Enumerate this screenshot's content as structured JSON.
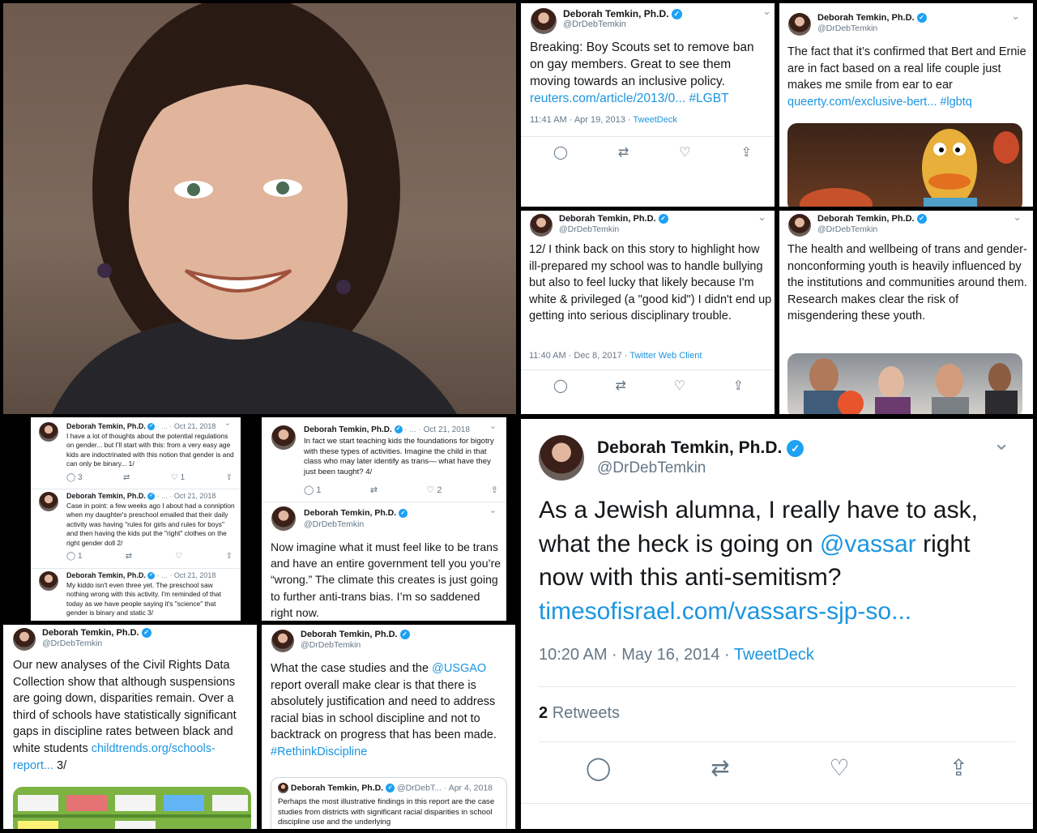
{
  "profile": {
    "name": "Deborah Temkin, Ph.D.",
    "handle": "@DrDebTemkin",
    "verified_mark": "✓"
  },
  "icons": {
    "reply": "reply-icon",
    "retweet": "retweet-icon",
    "like": "like-icon",
    "share": "share-icon",
    "chevron": "chevron-down-icon",
    "verified": "verified-badge-icon"
  },
  "glyphs": {
    "reply": "◯",
    "retweet": "⇄",
    "like": "♡",
    "share": "⇪",
    "chevron": "⌄"
  },
  "colors": {
    "link": "#1b95e0",
    "badge": "#1da1f2",
    "muted": "#657786"
  },
  "tweets": {
    "boy_scouts": {
      "text": "Breaking: Boy Scouts set to remove ban on gay members. Great to see them moving towards an inclusive policy.",
      "link": "reuters.com/article/2013/0...",
      "hashtag": "#LGBT",
      "time": "11:41 AM · Apr 19, 2013 ·",
      "source": "TweetDeck"
    },
    "bert_ernie": {
      "text": "The fact that it’s confirmed that Bert and Ernie are in fact based on a real life couple just makes me smile from ear to ear",
      "link": "queerty.com/exclusive-bert...",
      "hashtag": "#lgbtq"
    },
    "story_12": {
      "text": "12/ I think back on this story to highlight how ill-prepared my school was to handle bullying but also to feel lucky that likely because I'm white & privileged  (a \"good kid\") I didn't end up getting into serious disciplinary trouble.",
      "time": "11:40 AM · Dec 8, 2017 ·",
      "source": "Twitter Web Client"
    },
    "trans_youth": {
      "text": "The health and wellbeing of trans and gender-nonconforming youth is heavily influenced by the institutions and communities around them. Research makes clear the risk of misgendering these youth."
    },
    "thread": [
      {
        "date": "Oct 21, 2018",
        "text": "I have a lot of thoughts about the potential regulations on gender... but I'll start with this: from a very easy age kids are indoctrinated with this notion that gender is and can only be binary... 1/",
        "replies": "3",
        "likes": "1"
      },
      {
        "date": "Oct 21, 2018",
        "text": "Case in point: a few weeks ago I about had a conniption when my daughter's preschool emailed that their daily activity was having \"rules for girls and rules for boys\" and then having the kids put the \"right\" clothes on the right gender doll 2/",
        "replies": "1",
        "likes": ""
      },
      {
        "date": "Oct 21, 2018",
        "text": "My kiddo isn't even three yet. The preschool saw nothing wrong with this activity. I'm reminded of that today as we have people saying it's \"science\" that gender is binary and static 3/",
        "replies": "",
        "likes": ""
      }
    ],
    "thread4": {
      "date": "Oct 21, 2018",
      "text": "In fact we start teaching kids the foundations for bigotry with these types of activities. Imagine the child in that class who may later identify as trans— what have they just been taught? 4/",
      "replies": "1",
      "likes": "2"
    },
    "imagine": {
      "text": "Now imagine what it must feel like to be trans and have an entire government tell you you’re “wrong.” The climate this creates is just going to further anti-trans bias. I’m so saddened right now."
    },
    "crdc": {
      "text": "Our new analyses of the Civil Rights Data Collection show that although suspensions are going down, disparities remain. Over a third of schools have statistically significant gaps in discipline rates between black and white students",
      "link": "childtrends.org/schools-report...",
      "suffix": "3/"
    },
    "usgao": {
      "text_pre": "What the case studies and the",
      "mention": "@USGAO",
      "text_post": "report overall make clear is that there is absolutely justification and need to address racial bias in school discipline and not to backtrack on progress that has been made.",
      "hashtag": "#RethinkDiscipline",
      "quoted": {
        "handle": "@DrDebT...",
        "date": "Apr 4, 2018",
        "text": "Perhaps the most illustrative findings in this report are the case studies from districts with significant racial disparities in school discipline use and the underlying"
      }
    },
    "vassar": {
      "text_pre": "As a Jewish alumna, I really have to ask, what the heck is going on",
      "mention": "@vassar",
      "text_post": "right now with this anti-semitism?",
      "link": "timesofisrael.com/vassars-sjp-so...",
      "time": "10:20 AM · May 16, 2014 ·",
      "source": "TweetDeck",
      "retweet_count": "2",
      "retweet_label": "Retweets"
    }
  }
}
